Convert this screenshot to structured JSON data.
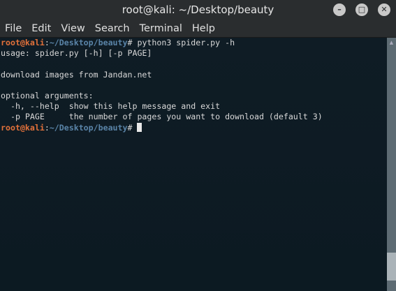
{
  "window": {
    "title": "root@kali: ~/Desktop/beauty",
    "buttons": [
      "minimize-icon",
      "maximize-icon",
      "close-icon"
    ]
  },
  "menu": [
    "File",
    "Edit",
    "View",
    "Search",
    "Terminal",
    "Help"
  ],
  "terminal": {
    "prompt_user": "root@kali",
    "prompt_sep": ":",
    "prompt_path": "~/Desktop/beauty",
    "prompt_end": "# ",
    "command": "python3 spider.py -h",
    "output": [
      "usage: spider.py [-h] [-p PAGE]",
      "",
      "download images from Jandan.net",
      "",
      "optional arguments:",
      "  -h, --help  show this help message and exit",
      "  -p PAGE     the number of pages you want to download (default 3)"
    ]
  },
  "scrollbar": {
    "position_percent": 92
  }
}
